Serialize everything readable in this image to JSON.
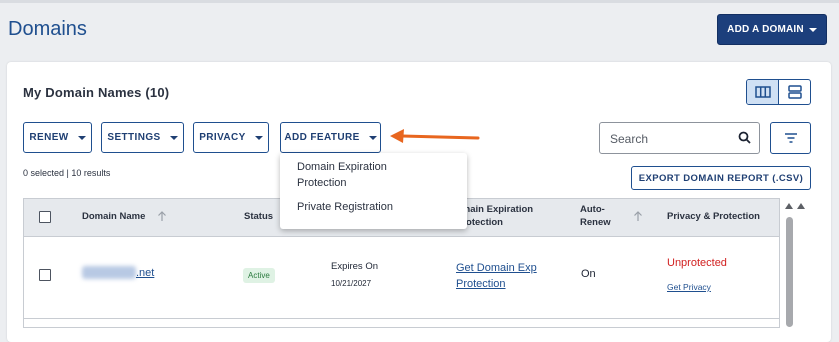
{
  "page": {
    "title": "Domains",
    "add_domain_label": "ADD A DOMAIN"
  },
  "card": {
    "title": "My Domain Names (10)"
  },
  "toolbar": {
    "renew_label": "RENEW",
    "settings_label": "SETTINGS",
    "privacy_label": "PRIVACY",
    "add_feature_label": "ADD FEATURE",
    "search_placeholder": "Search"
  },
  "add_feature_menu": {
    "items": [
      {
        "label": "Domain Expiration Protection"
      },
      {
        "label": "Private Registration"
      }
    ]
  },
  "results_text": "0 selected | 10 results",
  "export_label": "EXPORT DOMAIN REPORT (.CSV)",
  "table": {
    "headers": {
      "domain_name": "Domain Name",
      "status": "Status",
      "expiration_protection": "omain Expiration Protection",
      "auto_renew": "Auto-Renew",
      "privacy": "Privacy & Protection"
    },
    "rows": [
      {
        "domain_suffix": ".net",
        "status": "Active",
        "expires_label": "Expires On",
        "expires_date": "10/21/2027",
        "exp_protection_link": "Get Domain Exp Protection",
        "auto_renew": "On",
        "privacy_status": "Unprotected",
        "privacy_link": "Get Privacy"
      }
    ]
  },
  "colors": {
    "accent": "#1c3f7c",
    "unprotected": "#d11f1f",
    "arrow": "#e8661f"
  }
}
